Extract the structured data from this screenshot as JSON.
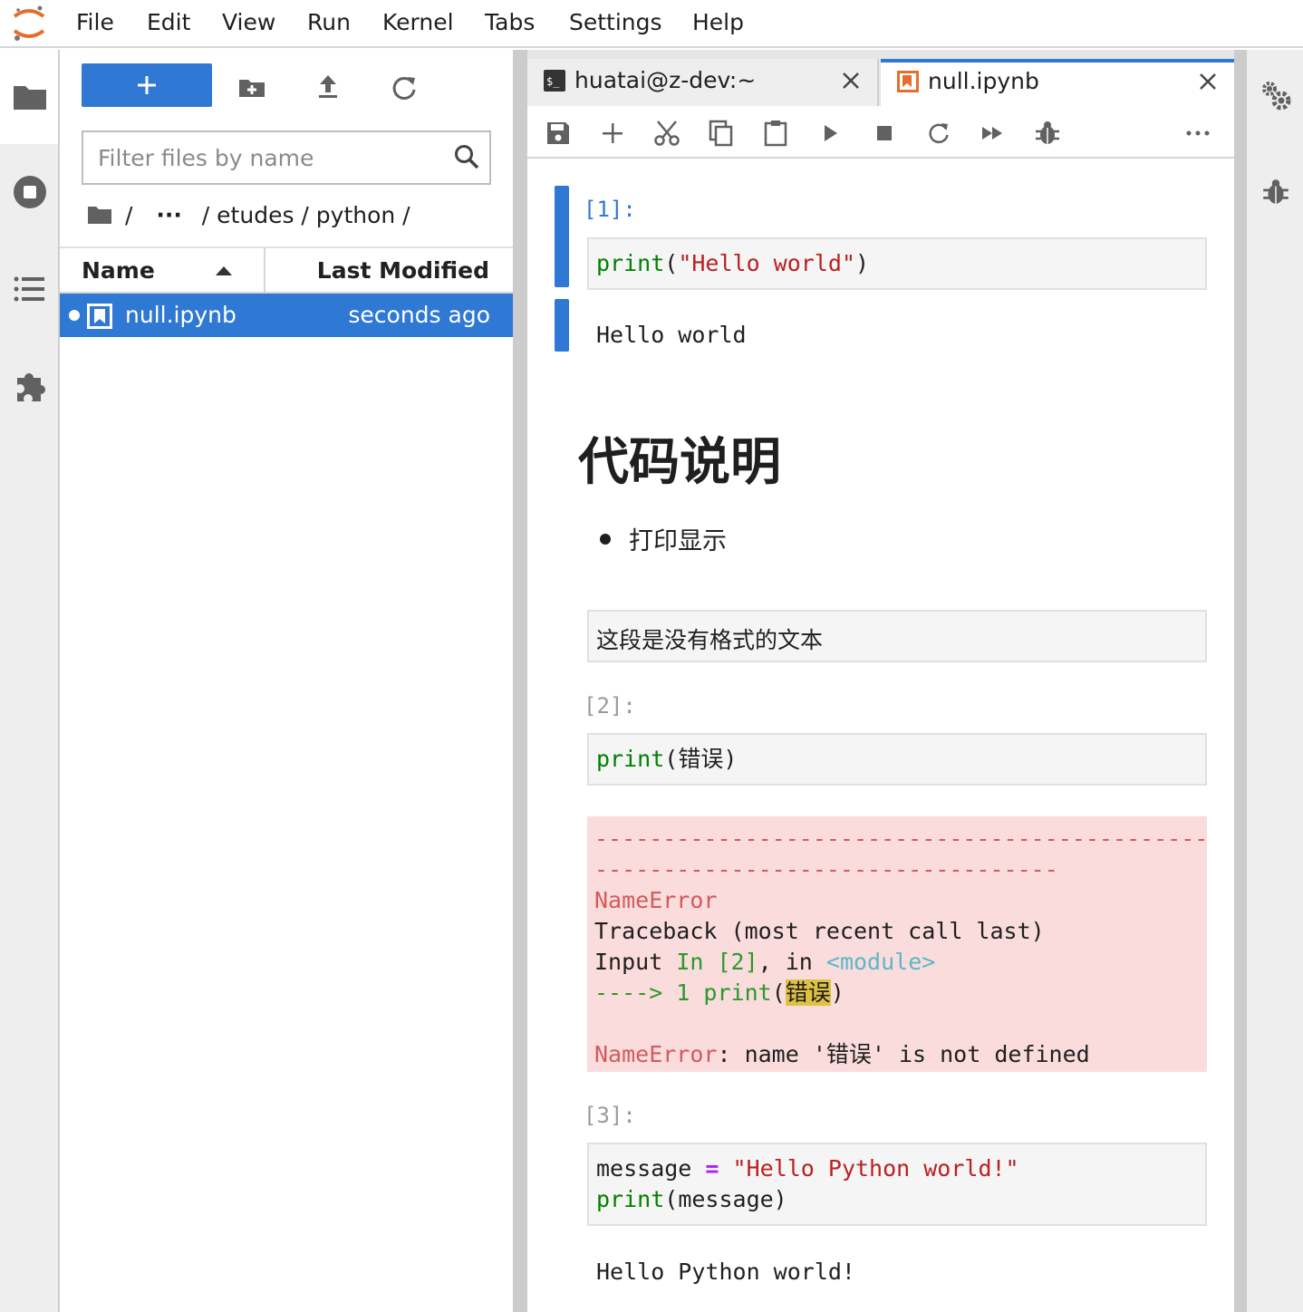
{
  "menu": [
    "File",
    "Edit",
    "View",
    "Run",
    "Kernel",
    "Tabs",
    "Settings",
    "Help"
  ],
  "filebrowser": {
    "filter_placeholder": "Filter files by name",
    "breadcrumb": {
      "root": "/",
      "ellipsis": "···",
      "path": "/ etudes / python /"
    },
    "columns": {
      "name": "Name",
      "modified": "Last Modified"
    },
    "files": [
      {
        "name": "null.ipynb",
        "modified": "seconds ago"
      }
    ]
  },
  "tabs": [
    {
      "label": "huatai@z-dev:~"
    },
    {
      "label": "null.ipynb"
    }
  ],
  "notebook": {
    "cell1": {
      "prompt": "[1]:",
      "code_fn": "print",
      "code_open": "(",
      "code_str": "\"Hello world\"",
      "code_close": ")",
      "output": "Hello world"
    },
    "markdown": {
      "heading": "代码说明",
      "bullet": "打印显示"
    },
    "raw": "这段是没有格式的文本",
    "cell2": {
      "prompt": "[2]:",
      "code_fn": "print",
      "code_rest": "(错误)",
      "error": {
        "dashes1": "---------------------------------------------",
        "dashes2": "----------------------------------",
        "ename": "NameError",
        "traceback": "Traceback (most recent call last)",
        "input_label": "Input ",
        "input_ref": "In [2]",
        "input_mid": ", in ",
        "module": "<module>",
        "arrow": "----> 1 ",
        "call_fn": "print",
        "call_open": "(",
        "call_arg": "错误",
        "call_close": ")",
        "msg_name": "NameError",
        "msg_text": ": name '错误' is not defined"
      }
    },
    "cell3": {
      "prompt": "[3]:",
      "line1_var": "message ",
      "line1_op": "=",
      "line1_str": " \"Hello Python world!\"",
      "line2_fn": "print",
      "line2_rest": "(message)",
      "output": "Hello Python world!"
    }
  },
  "colors": {
    "accent": "#2f78d3",
    "error_bg": "#fadcdc",
    "jupyter_orange": "#e46e2e"
  }
}
